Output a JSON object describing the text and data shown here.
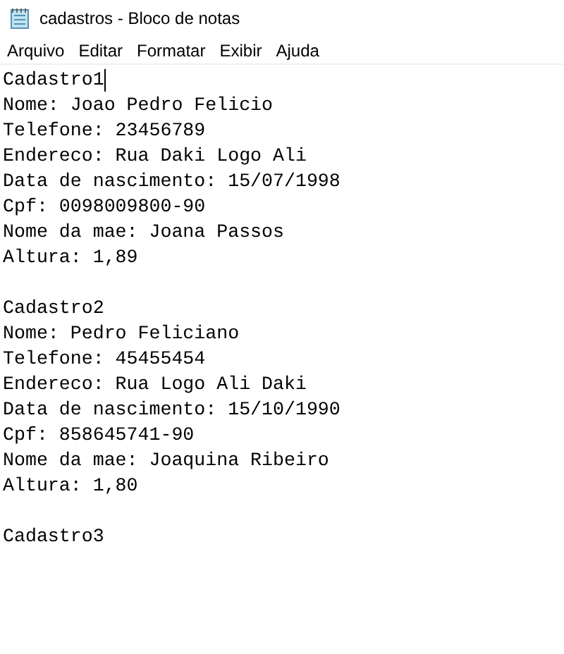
{
  "window": {
    "title": "cadastros - Bloco de notas"
  },
  "menu": [
    "Arquivo",
    "Editar",
    "Formatar",
    "Exibir",
    "Ajuda"
  ],
  "document": {
    "blocks": [
      {
        "lines": [
          {
            "text": "Cadastro1",
            "caret": true
          },
          {
            "text": "Nome: Joao Pedro Felicio",
            "caret": false
          },
          {
            "text": "Telefone: 23456789",
            "caret": false
          },
          {
            "text": "Endereco: Rua Daki Logo Ali",
            "caret": false
          },
          {
            "text": "Data de nascimento: 15/07/1998",
            "caret": false
          },
          {
            "text": "Cpf: 0098009800-90",
            "caret": false
          },
          {
            "text": "Nome da mae: Joana Passos",
            "caret": false
          },
          {
            "text": "Altura: 1,89",
            "caret": false
          }
        ]
      },
      {
        "lines": [
          {
            "text": "Cadastro2",
            "caret": false
          },
          {
            "text": "Nome: Pedro Feliciano",
            "caret": false
          },
          {
            "text": "Telefone: 45455454",
            "caret": false
          },
          {
            "text": "Endereco: Rua Logo Ali Daki",
            "caret": false
          },
          {
            "text": "Data de nascimento: 15/10/1990",
            "caret": false
          },
          {
            "text": "Cpf: 858645741-90",
            "caret": false
          },
          {
            "text": "Nome da mae: Joaquina Ribeiro",
            "caret": false
          },
          {
            "text": "Altura: 1,80",
            "caret": false
          }
        ]
      },
      {
        "lines": [
          {
            "text": "Cadastro3",
            "caret": false
          }
        ]
      }
    ]
  }
}
